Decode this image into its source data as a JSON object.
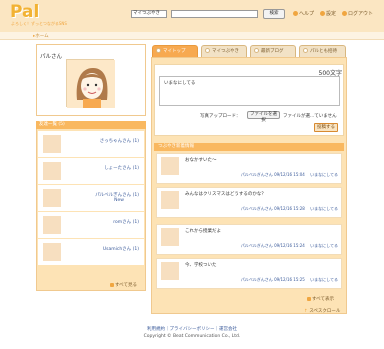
{
  "header": {
    "logo": "Pal",
    "logo_tagline": "よろしく！ずっとつながるSNS",
    "search_select": "マイつぶやき",
    "search_button": "検索",
    "nav": [
      "ヘルプ",
      "設定",
      "ログアウト"
    ]
  },
  "breadcrumb": {
    "home": "ホーム"
  },
  "profile": {
    "name": "パルさん"
  },
  "friends": {
    "title": "友達一覧 (5)",
    "items": [
      {
        "name": "さっちゃんさん (1)",
        "badge": ""
      },
      {
        "name": "しょーたさん (1)",
        "badge": ""
      },
      {
        "name": "パルベルぎんさん (1)",
        "badge": "New"
      },
      {
        "name": "romさん (1)",
        "badge": ""
      },
      {
        "name": "Usamichさん (1)",
        "badge": ""
      }
    ],
    "more": "すべて見る"
  },
  "tabs": [
    {
      "label": "マイトップ",
      "active": true
    },
    {
      "label": "マイつぶやき",
      "active": false
    },
    {
      "label": "最新ブログ",
      "active": false
    },
    {
      "label": "パルとも招待",
      "active": false
    }
  ],
  "post": {
    "char_count": "500文字",
    "text": "いまなにしてる",
    "photo_label": "写真アップロード：",
    "file_button": "ファイルを選択",
    "file_status": "ファイルが選...ていません",
    "submit": "投稿する"
  },
  "feed": {
    "title": "つぶやき新着情報",
    "items": [
      {
        "text": "おなかすいた〜",
        "author": "パルベルぎんさん",
        "time": "09/12/16 15:04",
        "like": "いまなにしてる"
      },
      {
        "text": "みんなはクリスマスはどうするのかな？",
        "author": "パルベルぎんさん",
        "time": "09/12/16 15:28",
        "like": "いまなにしてる"
      },
      {
        "text": "これから授業だよ",
        "author": "パルベルぎんさん",
        "time": "09/12/16 15:24",
        "like": "いまなにしてる"
      },
      {
        "text": "今、学校ついた",
        "author": "パルベルぎんさん",
        "time": "09/12/16 15:25",
        "like": "いまなにしてる"
      }
    ],
    "more": "すべて表示",
    "scroll_up": "スペスクロール"
  },
  "footer": {
    "links": "利用規約｜プライバシーポリシー｜運営会社",
    "copyright": "Copyright © Beat Communication Co., Ltd."
  },
  "colors": {
    "accent": "#f7a950",
    "panel": "#fde3b5",
    "header": "#fbe6c2",
    "link": "#3a5a9a"
  }
}
